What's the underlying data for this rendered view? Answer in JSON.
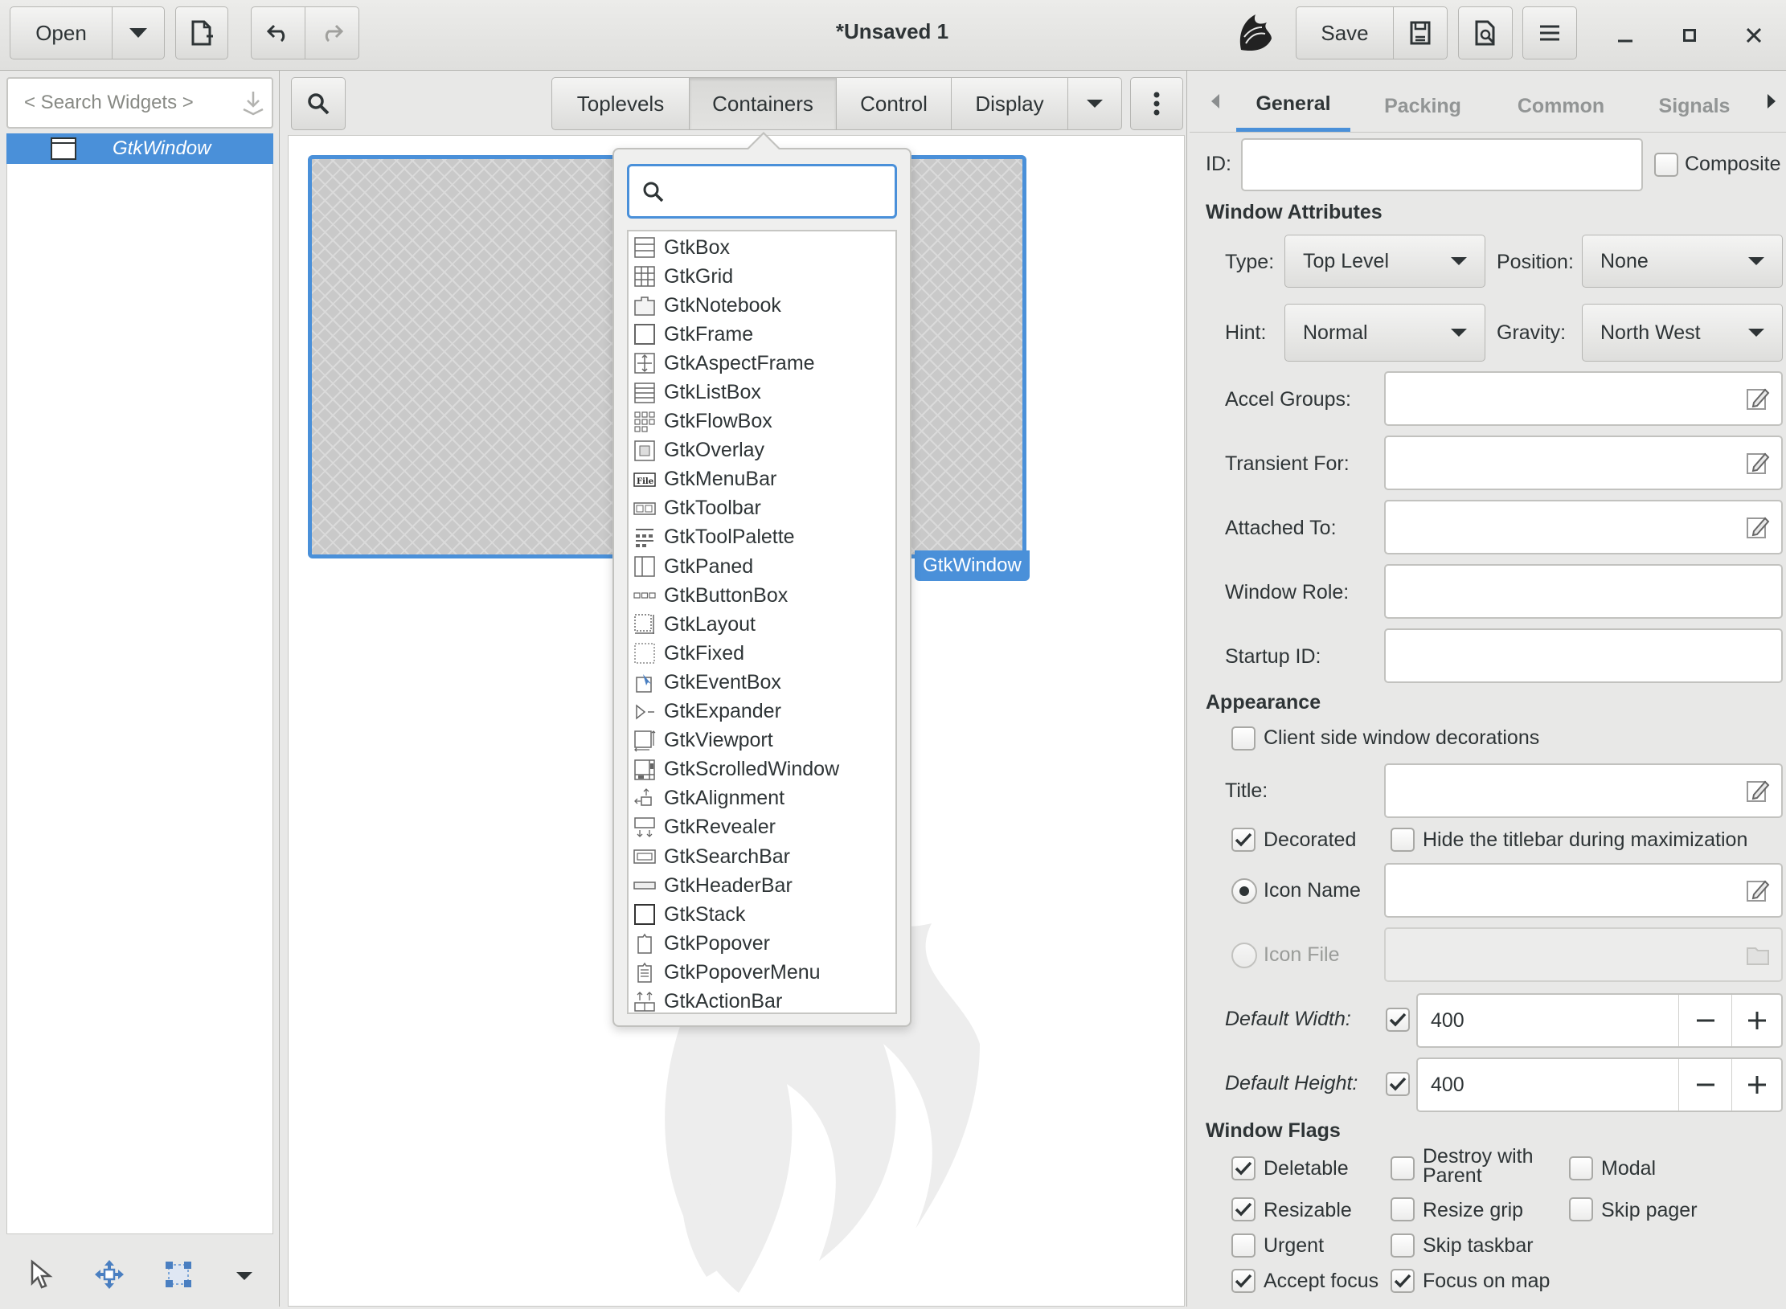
{
  "header": {
    "open_label": "Open",
    "title": "*Unsaved 1",
    "save_label": "Save"
  },
  "palette": {
    "search_placeholder": "< Search Widgets >",
    "tree": [
      {
        "label": "GtkWindow"
      }
    ]
  },
  "categories": {
    "tabs": [
      {
        "label": "Toplevels"
      },
      {
        "label": "Containers"
      },
      {
        "label": "Control"
      },
      {
        "label": "Display"
      }
    ],
    "active": "Containers"
  },
  "canvas": {
    "window_label": "GtkWindow"
  },
  "popover": {
    "search_value": "",
    "items": [
      {
        "label": "GtkBox",
        "icon": "box-icon"
      },
      {
        "label": "GtkGrid",
        "icon": "grid-icon"
      },
      {
        "label": "GtkNotebook",
        "icon": "notebook-icon"
      },
      {
        "label": "GtkFrame",
        "icon": "frame-icon"
      },
      {
        "label": "GtkAspectFrame",
        "icon": "aspect-frame-icon"
      },
      {
        "label": "GtkListBox",
        "icon": "list-box-icon"
      },
      {
        "label": "GtkFlowBox",
        "icon": "flow-box-icon"
      },
      {
        "label": "GtkOverlay",
        "icon": "overlay-icon"
      },
      {
        "label": "GtkMenuBar",
        "icon": "menu-bar-icon"
      },
      {
        "label": "GtkToolbar",
        "icon": "toolbar-icon"
      },
      {
        "label": "GtkToolPalette",
        "icon": "tool-palette-icon"
      },
      {
        "label": "GtkPaned",
        "icon": "paned-icon"
      },
      {
        "label": "GtkButtonBox",
        "icon": "button-box-icon"
      },
      {
        "label": "GtkLayout",
        "icon": "layout-icon"
      },
      {
        "label": "GtkFixed",
        "icon": "fixed-icon"
      },
      {
        "label": "GtkEventBox",
        "icon": "event-box-icon"
      },
      {
        "label": "GtkExpander",
        "icon": "expander-icon"
      },
      {
        "label": "GtkViewport",
        "icon": "viewport-icon"
      },
      {
        "label": "GtkScrolledWindow",
        "icon": "scrolled-window-icon"
      },
      {
        "label": "GtkAlignment",
        "icon": "alignment-icon"
      },
      {
        "label": "GtkRevealer",
        "icon": "revealer-icon"
      },
      {
        "label": "GtkSearchBar",
        "icon": "search-bar-icon"
      },
      {
        "label": "GtkHeaderBar",
        "icon": "header-bar-icon"
      },
      {
        "label": "GtkStack",
        "icon": "stack-icon"
      },
      {
        "label": "GtkPopover",
        "icon": "popover-icon"
      },
      {
        "label": "GtkPopoverMenu",
        "icon": "popover-menu-icon"
      },
      {
        "label": "GtkActionBar",
        "icon": "action-bar-icon"
      }
    ]
  },
  "props": {
    "tabs": [
      {
        "label": "General"
      },
      {
        "label": "Packing"
      },
      {
        "label": "Common"
      },
      {
        "label": "Signals"
      }
    ],
    "active_tab": "General",
    "id_label": "ID:",
    "id_value": "",
    "composite_label": "Composite",
    "window_attributes_heading": "Window Attributes",
    "type_label": "Type:",
    "type_value": "Top Level",
    "position_label": "Position:",
    "position_value": "None",
    "hint_label": "Hint:",
    "hint_value": "Normal",
    "gravity_label": "Gravity:",
    "gravity_value": "North West",
    "accel_groups_label": "Accel Groups:",
    "transient_for_label": "Transient For:",
    "attached_to_label": "Attached To:",
    "window_role_label": "Window Role:",
    "startup_id_label": "Startup ID:",
    "appearance_heading": "Appearance",
    "csd_label": "Client side window decorations",
    "title_label": "Title:",
    "decorated_label": "Decorated",
    "hide_titlebar_label": "Hide the titlebar during maximization",
    "icon_name_label": "Icon Name",
    "icon_file_label": "Icon File",
    "default_width_label": "Default Width:",
    "default_width_value": "400",
    "default_height_label": "Default Height:",
    "default_height_value": "400",
    "window_flags_heading": "Window Flags",
    "flags": {
      "deletable": "Deletable",
      "destroy_with_parent": "Destroy with Parent",
      "modal": "Modal",
      "resizable": "Resizable",
      "resize_grip": "Resize grip",
      "skip_pager": "Skip pager",
      "urgent": "Urgent",
      "skip_taskbar": "Skip taskbar",
      "accept_focus": "Accept focus",
      "focus_on_map": "Focus on map"
    }
  },
  "colors": {
    "accent": "#4a90d9",
    "selection": "#4a90d9",
    "text": "#2e3436"
  }
}
